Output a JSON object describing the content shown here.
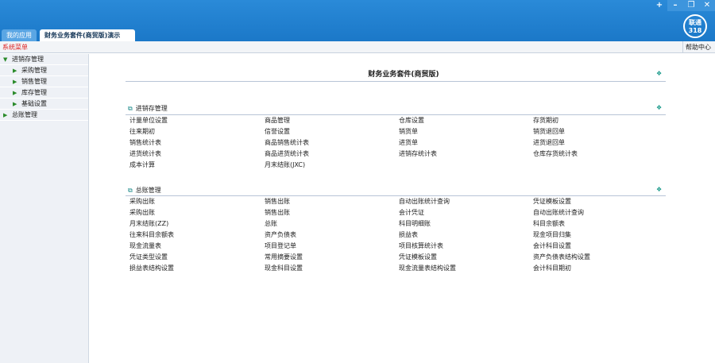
{
  "window": {
    "controls": [
      "+",
      "–",
      "❐",
      "✕"
    ],
    "logo_line1": "联通",
    "logo_line2": "318"
  },
  "tabs": [
    {
      "label": "我的应用"
    },
    {
      "label": "财务业务套件(商贸版)演示"
    }
  ],
  "toolbar": {
    "system_menu": "系统菜单",
    "help": "帮助中心"
  },
  "sidebar": {
    "items": [
      {
        "label": "进销存管理",
        "expanded": true
      },
      {
        "label": "采购管理"
      },
      {
        "label": "销售管理"
      },
      {
        "label": "库存管理"
      },
      {
        "label": "基础设置"
      },
      {
        "label": "总账管理",
        "expanded": false
      }
    ]
  },
  "main": {
    "title": "财务业务套件(商贸版)",
    "sections": [
      {
        "title": "进销存管理",
        "items": [
          "计量单位设置",
          "商品管理",
          "仓库设置",
          "存货期初",
          "往来期初",
          "信誉设置",
          "销货单",
          "销货退回单",
          "销售统计表",
          "商品销售统计表",
          "进货单",
          "进货退回单",
          "进货统计表",
          "商品进货统计表",
          "进销存统计表",
          "仓库存货统计表",
          "成本计算",
          "月末结账(JXC)"
        ]
      },
      {
        "title": "总账管理",
        "items": [
          "采购出账",
          "销售出账",
          "自动出账统计查询",
          "凭证模板设置",
          "采购出账",
          "销售出账",
          "会计凭证",
          "自动出账统计查询",
          "月末结账(ZZ)",
          "总账",
          "科目明细账",
          "科目余额表",
          "往来科目余额表",
          "资产负债表",
          "损益表",
          "现金项目归集",
          "现金流量表",
          "项目登记单",
          "项目核算统计表",
          "会计科目设置",
          "凭证类型设置",
          "常用摘要设置",
          "凭证模板设置",
          "资产负债表结构设置",
          "损益表结构设置",
          "现金科目设置",
          "现金流量表结构设置",
          "会计科目期初"
        ]
      }
    ]
  }
}
